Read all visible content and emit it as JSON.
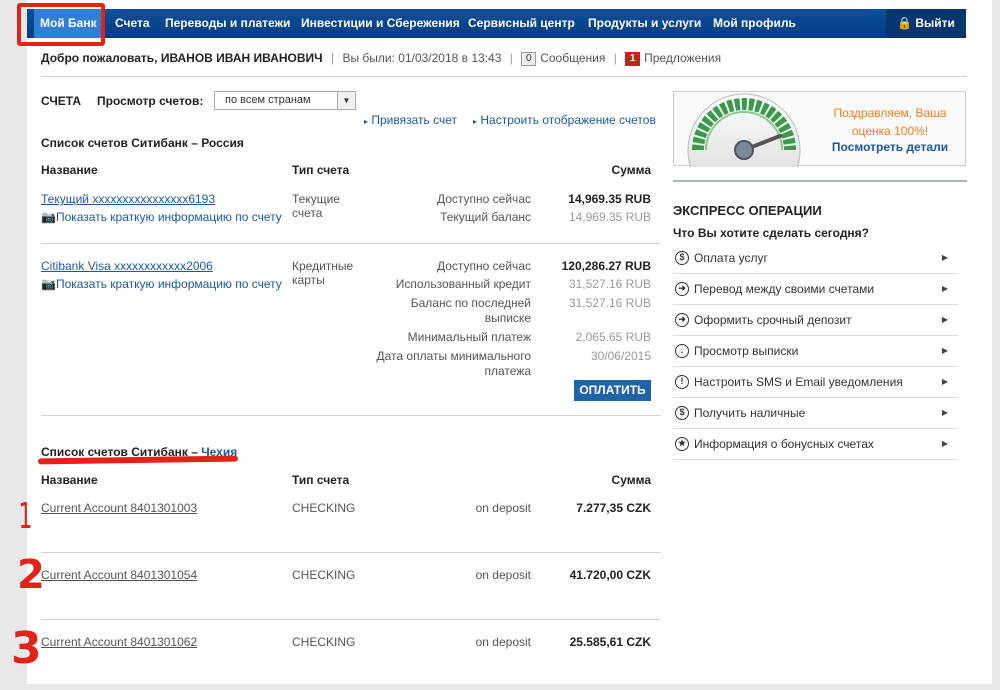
{
  "nav": {
    "items": [
      "Мой Банк",
      "Счета",
      "Переводы и платежи",
      "Инвестиции и Сбережения",
      "Сервисный центр",
      "Продукты и услуги",
      "Мой профиль"
    ],
    "logout": "Выйти"
  },
  "welcome": {
    "greeting": "Добро пожаловать,",
    "name": "ИВАНОВ ИВАН ИВАНОВИЧ",
    "last_visit": "Вы были: 01/03/2018 в 13:43",
    "messages_count": "0",
    "messages": "Сообщения",
    "offers_count": "1",
    "offers": "Предложения"
  },
  "accounts": {
    "title": "СЧЕТА",
    "view_label": "Просмотр счетов:",
    "view_value": "по всем странам",
    "link_bind": "Привязать счет",
    "link_settings": "Настроить отображение счетов",
    "columns": {
      "name": "Название",
      "type": "Тип счета",
      "amount": "Сумма"
    },
    "russia": {
      "title": "Список счетов Ситибанк – Россия",
      "current": {
        "name": "Текущий xxxxxxxxxxxxxxxx6193",
        "info": "Показать краткую информацию по счету",
        "type": "Текущие счета",
        "rows": [
          {
            "label": "Доступно сейчас",
            "value": "14,969.35 RUB"
          },
          {
            "label": "Текущий баланс",
            "value": "14,969.35 RUB"
          }
        ]
      },
      "visa": {
        "name": "Citibank Visa xxxxxxxxxxxx2006",
        "info": "Показать краткую информацию по счету",
        "type": "Кредитные карты",
        "rows": [
          {
            "label": "Доступно сейчас",
            "value": "120,286.27 RUB"
          },
          {
            "label": "Использованный кредит",
            "value": "31,527.16 RUB"
          },
          {
            "label": "Баланс по последней выписке",
            "value": "31,527.16 RUB"
          },
          {
            "label": "Минимальный платеж",
            "value": "2,065.65 RUB"
          },
          {
            "label": "Дата оплаты минимального платежа",
            "value": "30/06/2015"
          }
        ],
        "pay": "ОПЛАТИТЬ"
      }
    },
    "czech": {
      "title_prefix": "Список счетов Ситибанк –",
      "title_country": "Чехия",
      "rows": [
        {
          "name": "Current Account 8401301003",
          "type": "CHECKING",
          "status": "on deposit",
          "amount": "7.277,35 CZK"
        },
        {
          "name": "Current Account 8401301054",
          "type": "CHECKING",
          "status": "on deposit",
          "amount": "41.720,00 CZK"
        },
        {
          "name": "Current Account 8401301062",
          "type": "CHECKING",
          "status": "on deposit",
          "amount": "25.585,61 CZK"
        }
      ]
    }
  },
  "score": {
    "congrats": "Поздравляем, Ваша оценка 100%!",
    "details": "Посмотреть детали"
  },
  "express": {
    "title": "ЭКСПРЕСС ОПЕРАЦИИ",
    "subtitle": "Что Вы хотите сделать сегодня?",
    "items": [
      {
        "label": "Оплата услуг",
        "icon": "dollar-icon"
      },
      {
        "label": "Перевод между своими счетами",
        "icon": "transfer-icon"
      },
      {
        "label": "Оформить срочный депозит",
        "icon": "deposit-icon"
      },
      {
        "label": "Просмотр выписки",
        "icon": "download-icon"
      },
      {
        "label": "Настроить SMS и Email уведомления",
        "icon": "alert-icon"
      },
      {
        "label": "Получить наличные",
        "icon": "dollar-icon"
      },
      {
        "label": "Информация о бонусных счетах",
        "icon": "star-icon"
      }
    ]
  },
  "annotations": [
    "1",
    "2",
    "3"
  ],
  "colors": {
    "nav_bg": "#0a4f9e",
    "nav_active": "#2f7fd6",
    "annotation": "#e2231a",
    "link": "#1a5a9a",
    "accent_orange": "#f07f1a"
  }
}
